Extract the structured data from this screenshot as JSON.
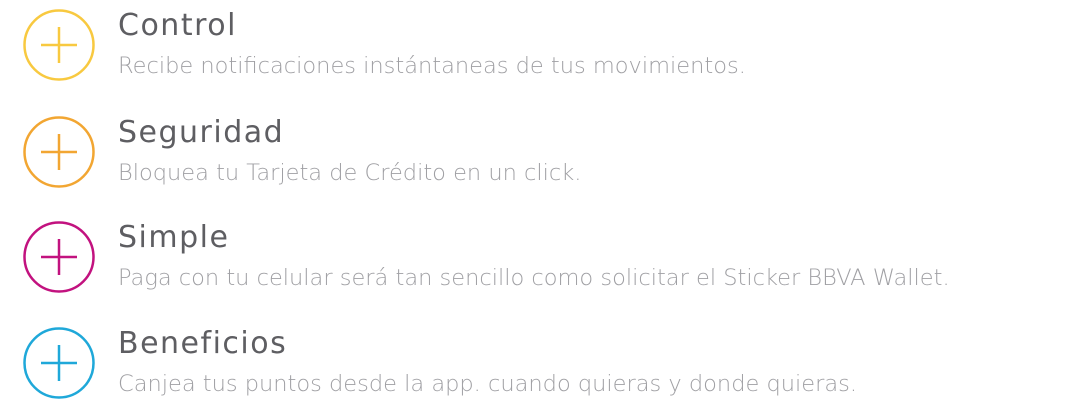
{
  "features": [
    {
      "title": "Control",
      "description": "Recibe notificaciones instántaneas de tus movimientos.",
      "icon": "plus-circle-icon",
      "color": "#f8c940"
    },
    {
      "title": "Seguridad",
      "description": "Bloquea tu Tarjeta de Crédito en un click.",
      "icon": "plus-circle-icon",
      "color": "#f2a632"
    },
    {
      "title": "Simple",
      "description": "Paga con tu celular será tan sencillo como solicitar el Sticker BBVA Wallet.",
      "icon": "plus-circle-icon",
      "color": "#c2127f"
    },
    {
      "title": "Beneficios",
      "description": "Canjea tus puntos desde la app. cuando quieras y donde quieras.",
      "icon": "plus-circle-icon",
      "color": "#1fa8d9"
    }
  ]
}
